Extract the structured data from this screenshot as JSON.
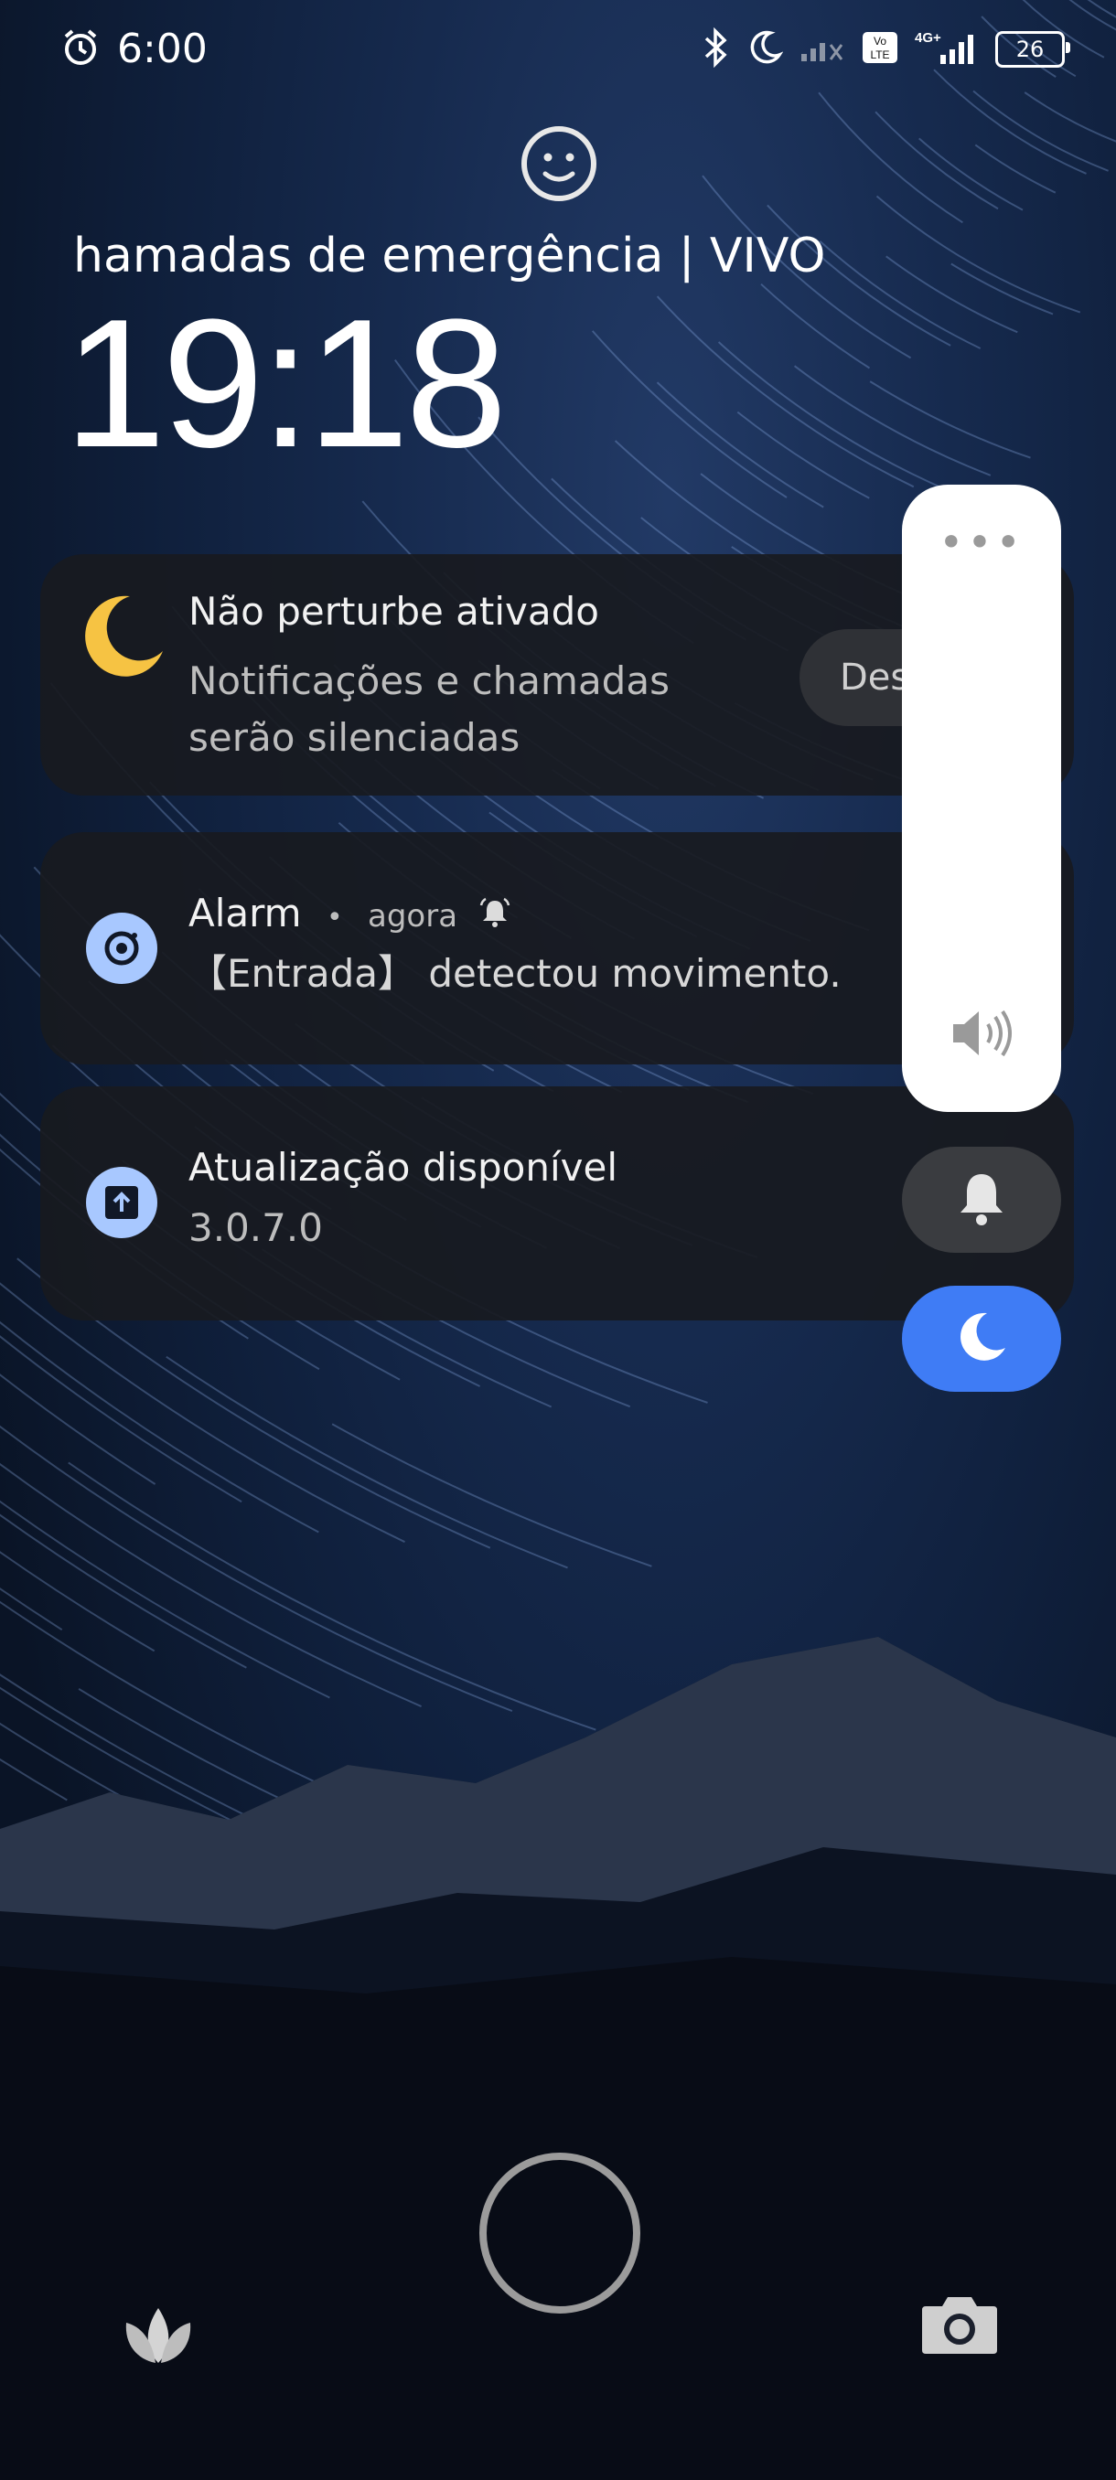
{
  "status_bar": {
    "time": "6:00",
    "battery": "26",
    "icons": [
      "alarm-clock-icon",
      "bluetooth-icon",
      "moon-icon",
      "signal-off-icon",
      "volte-icon",
      "4g-plus-signal-icon",
      "battery-icon"
    ]
  },
  "lock": {
    "carrier_text": "hamadas de emergência | VIVO",
    "clock": "19:18"
  },
  "notifications": [
    {
      "icon": "moon-icon",
      "title": "Não perturbe ativado",
      "body_line1": "Notificações e chamadas",
      "body_line2": "serão silenciadas",
      "action_label": "Desativar"
    },
    {
      "icon": "camera-target-icon",
      "app": "Alarm",
      "separator": "•",
      "time": "agora",
      "body": "【Entrada】 detectou movimento."
    },
    {
      "icon": "upload-icon",
      "title": "Atualização disponível",
      "body": "3.0.7.0"
    }
  ],
  "volume_panel": {
    "more_label": "•••",
    "icons": [
      "speaker-icon",
      "bell-icon",
      "moon-icon"
    ],
    "accent": "#3f7cf5"
  },
  "bottom": {
    "icons": [
      "leaf-icon",
      "camera-icon"
    ]
  }
}
